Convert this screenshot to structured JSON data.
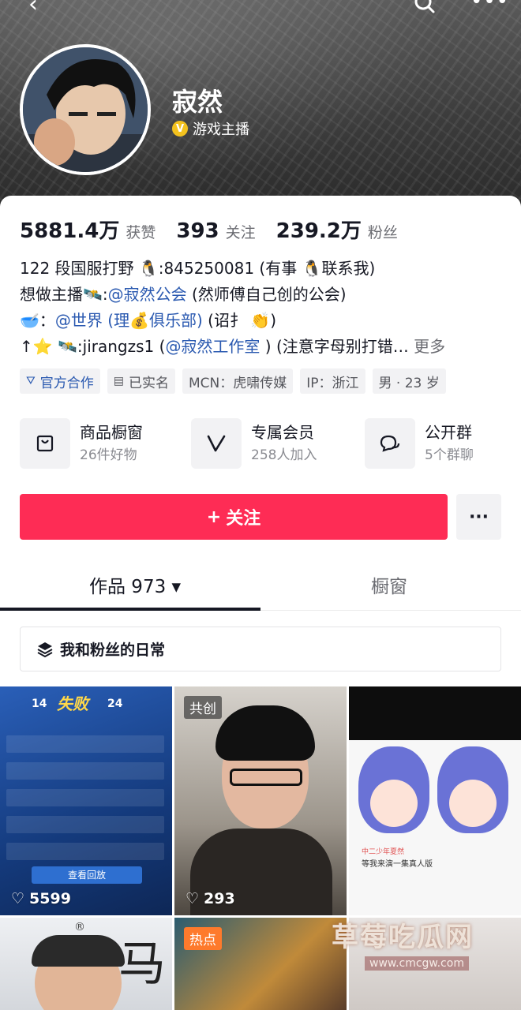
{
  "header": {
    "nickname": "寂然",
    "verify_label": "游戏主播",
    "back_icon": "chevron-left-icon",
    "search_icon": "search-icon",
    "more_icon": "more-horizontal-icon"
  },
  "stats": [
    {
      "value": "5881.4万",
      "label": "获赞"
    },
    {
      "value": "393",
      "label": "关注"
    },
    {
      "value": "239.2万",
      "label": "粉丝"
    }
  ],
  "bio": {
    "line1": "122 段国服打野 🐧:845250081 (有事 🐧联系我)",
    "line2_prefix": "想做主播🛰️:",
    "line2_mention": "@寂然公会",
    "line2_suffix": " (然师傅自己创的公会)",
    "line3_prefix": "🥣：",
    "line3_mention": "@世界 (理💰俱乐部)",
    "line3_suffix": " (诏扌 👏)",
    "line4_prefix": "↑⭐ 🛰️:jirangzs1 (",
    "line4_mention": "@寂然工作室",
    "line4_suffix": " ) (注意字母别打错…",
    "more_label": "更多"
  },
  "tags": {
    "official": "官方合作",
    "realname": "已实名",
    "mcn": "MCN：虎啸传媒",
    "ip": "IP：浙江",
    "gender_age": "男 · 23 岁"
  },
  "shortcuts": [
    {
      "title": "商品橱窗",
      "sub": "26件好物",
      "icon": "shopping-bag-icon"
    },
    {
      "title": "专属会员",
      "sub": "258人加入",
      "icon": "member-v-icon"
    },
    {
      "title": "公开群",
      "sub": "5个群聊",
      "icon": "group-chat-icon"
    }
  ],
  "follow": {
    "label": "关注",
    "plus": "+"
  },
  "tabs": {
    "works": "作品 973 ▾",
    "shop": "橱窗"
  },
  "collection": {
    "label": "我和粉丝的日常"
  },
  "videos": [
    {
      "likes": "5599",
      "badge": ""
    },
    {
      "likes": "293",
      "badge": "共创"
    },
    {
      "likes": "",
      "badge": ""
    },
    {
      "likes": "",
      "badge": ""
    },
    {
      "likes": "",
      "badge": "热点"
    },
    {
      "likes": "",
      "badge": ""
    }
  ],
  "thumb1": {
    "left_score": "14",
    "right_score": "24",
    "title": "失败",
    "replay": "查看回放"
  },
  "thumb3": {
    "caption_user": "中二少年夏然",
    "caption_text": "等我来演一集真人版"
  },
  "thumb4": {
    "r_mark": "®",
    "calli": "马"
  },
  "watermark": {
    "title": "草莓吃瓜网",
    "url": "www.cmcgw.com"
  },
  "colors": {
    "follow": "#fe2c55",
    "mention": "#2a59b0",
    "verify": "#f4c21e",
    "hot": "#fe7a2c"
  }
}
